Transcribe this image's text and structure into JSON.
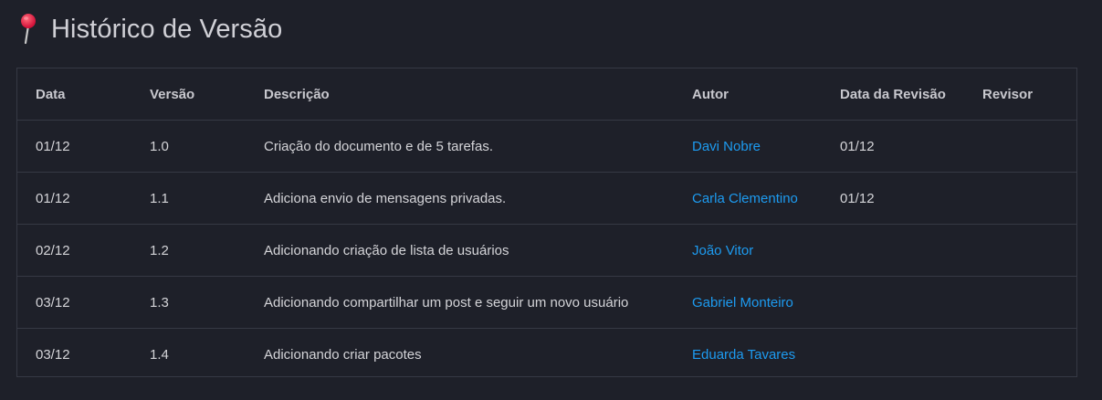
{
  "page": {
    "title": "Histórico de Versão",
    "icon": "pushpin-icon",
    "accent_color": "#1d9bf0"
  },
  "table": {
    "headers": [
      "Data",
      "Versão",
      "Descrição",
      "Autor",
      "Data da Revisão",
      "Revisor"
    ],
    "rows": [
      {
        "date": "01/12",
        "version": "1.0",
        "description": "Criação do documento e de 5 tarefas.",
        "author": "Davi Nobre",
        "review_date": "01/12",
        "reviewer": ""
      },
      {
        "date": "01/12",
        "version": "1.1",
        "description": "Adiciona envio de mensagens privadas.",
        "author": "Carla Clementino",
        "review_date": "01/12",
        "reviewer": ""
      },
      {
        "date": "02/12",
        "version": "1.2",
        "description": "Adicionando criação de lista de usuários",
        "author": "João Vitor",
        "review_date": "",
        "reviewer": ""
      },
      {
        "date": "03/12",
        "version": "1.3",
        "description": "Adicionando compartilhar um post e seguir um novo usuário",
        "author": "Gabriel Monteiro",
        "review_date": "",
        "reviewer": ""
      },
      {
        "date": "03/12",
        "version": "1.4",
        "description": "Adicionando criar pacotes",
        "author": "Eduarda Tavares",
        "review_date": "",
        "reviewer": ""
      }
    ]
  }
}
